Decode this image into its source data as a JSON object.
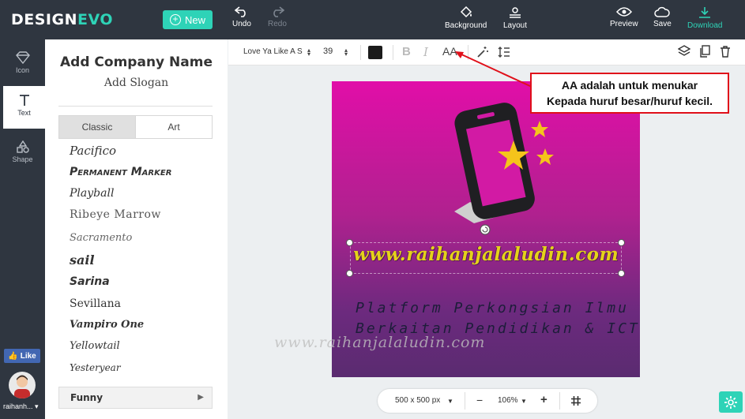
{
  "app": {
    "logo_design": "DESIGN",
    "logo_evo": "EVO",
    "new_label": "New"
  },
  "toolbar": {
    "undo": "Undo",
    "redo": "Redo",
    "background": "Background",
    "layout": "Layout",
    "preview": "Preview",
    "save": "Save",
    "download": "Download"
  },
  "rail": {
    "icon": "Icon",
    "text": "Text",
    "shape": "Shape",
    "like": "Like",
    "user": "raihanh..."
  },
  "panel": {
    "add_company": "Add Company Name",
    "add_slogan": "Add Slogan",
    "tab_classic": "Classic",
    "tab_art": "Art",
    "fonts": [
      "Pacifico",
      "Permanent Marker",
      "Playball",
      "Ribeye Marrow",
      "Sacramento",
      "sail",
      "Sarina",
      "Sevillana",
      "Vampiro One",
      "Yellowtail",
      "Yesteryear"
    ],
    "category": "Funny"
  },
  "text_toolbar": {
    "font": "Love Ya Like A Sister",
    "size": "39",
    "bold": "B",
    "italic": "I",
    "case": "AA"
  },
  "canvas": {
    "website": "www.raihanjalaludin.com",
    "tagline1": "Platform Perkongsian Ilmu",
    "tagline2": "Berkaitan Pendidikan & ICT",
    "watermark": "www.raihanjalaludin.com",
    "bg_top": "#e10ea8",
    "bg_bottom": "#5a2b70"
  },
  "callout": {
    "line1": "AA adalah untuk menukar",
    "line2": "Kepada huruf besar/huruf kecil."
  },
  "bottom": {
    "size": "500 x 500 px",
    "zoom": "106%",
    "minus": "−",
    "plus": "+"
  },
  "colors": {
    "accent": "#2ed3b7",
    "dark": "#2f3640",
    "callout_border": "#e0101a"
  }
}
